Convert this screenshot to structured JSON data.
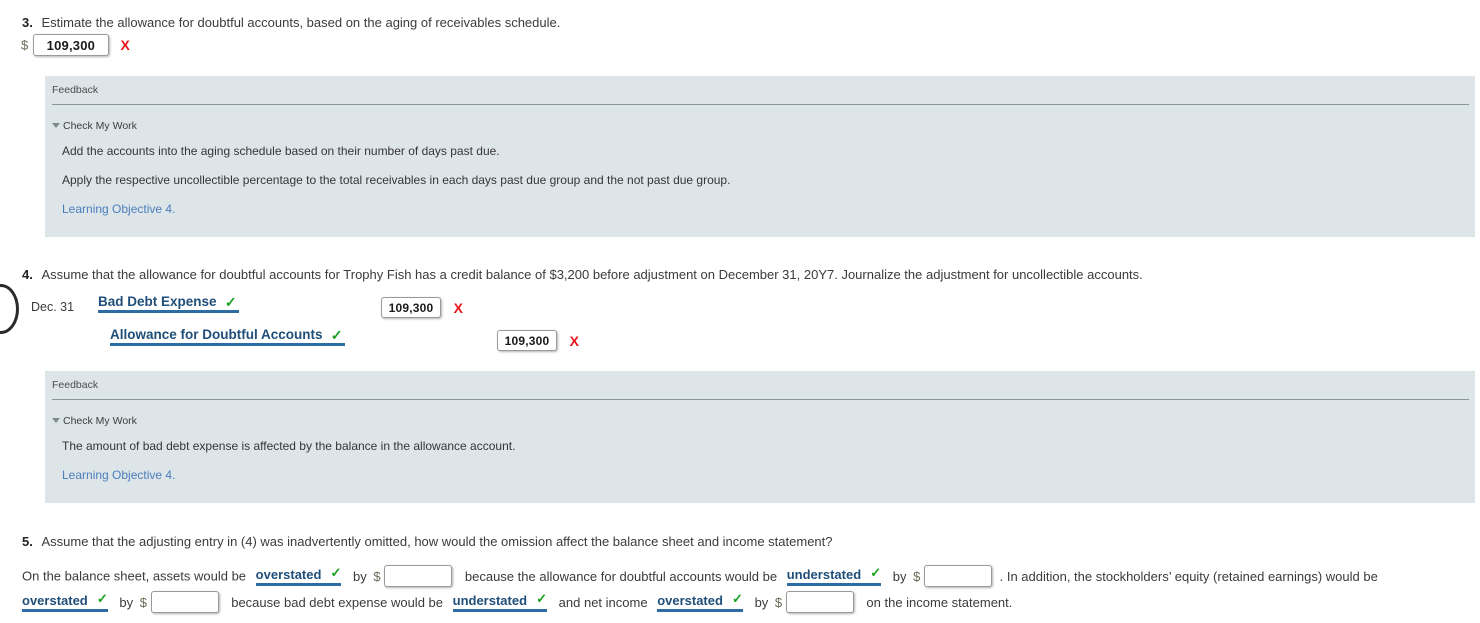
{
  "question3": {
    "number": "3.",
    "prompt": "Estimate the allowance for doubtful accounts, based on the aging of receivables schedule.",
    "currency_symbol": "$",
    "answer_value": "109,300",
    "answer_mark": "X",
    "feedback": {
      "title": "Feedback",
      "toggle_label": "Check My Work",
      "lines": [
        "Add the accounts into the aging schedule based on their number of days past due.",
        "Apply the respective uncollectible percentage to the total receivables in each days past due group and the not past due group."
      ],
      "link": "Learning Objective 4."
    }
  },
  "question4": {
    "number": "4.",
    "prompt": "Assume that the allowance for doubtful accounts for Trophy Fish has a credit balance of $3,200 before adjustment on December 31, 20Y7. Journalize the adjustment for uncollectible accounts.",
    "journal": {
      "date": "Dec. 31",
      "rows": [
        {
          "account": "Bad Debt Expense",
          "account_mark": "✓",
          "amount": "109,300",
          "amount_mark": "X"
        },
        {
          "account": "Allowance for Doubtful Accounts",
          "account_mark": "✓",
          "amount": "109,300",
          "amount_mark": "X"
        }
      ]
    },
    "feedback": {
      "title": "Feedback",
      "toggle_label": "Check My Work",
      "lines": [
        "The amount of bad debt expense is affected by the balance in the allowance account."
      ],
      "link": "Learning Objective 4."
    }
  },
  "question5": {
    "number": "5.",
    "prompt": "Assume that the adjusting entry in (4) was inadvertently omitted, how would the omission affect the balance sheet and income statement?",
    "line1": {
      "t1": "On the balance sheet, assets would be",
      "dd1": "overstated",
      "dd1_mark": "✓",
      "t2": "by",
      "dollar": "$",
      "input1": "",
      "t3": "because the allowance for doubtful accounts would be",
      "dd2": "understated",
      "dd2_mark": "✓",
      "t4": "by",
      "dollar2": "$",
      "input2": "",
      "t5": ". In addition, the stockholders’ equity (retained earnings) would be"
    },
    "line2": {
      "dd3": "overstated",
      "dd3_mark": "✓",
      "t1": "by",
      "dollar": "$",
      "input3": "",
      "t2": "because bad debt expense would be",
      "dd4": "understated",
      "dd4_mark": "✓",
      "t3": "and net income",
      "dd5": "overstated",
      "dd5_mark": "✓",
      "t4": "by",
      "dollar2": "$",
      "input4": "",
      "t5": "on the income statement."
    }
  },
  "colors": {
    "feedback_bg": "#dee5e9",
    "link": "#4a7ebb",
    "account_blue": "#1f4e79",
    "check_green": "#17a01e",
    "x_red": "#e8141b"
  }
}
